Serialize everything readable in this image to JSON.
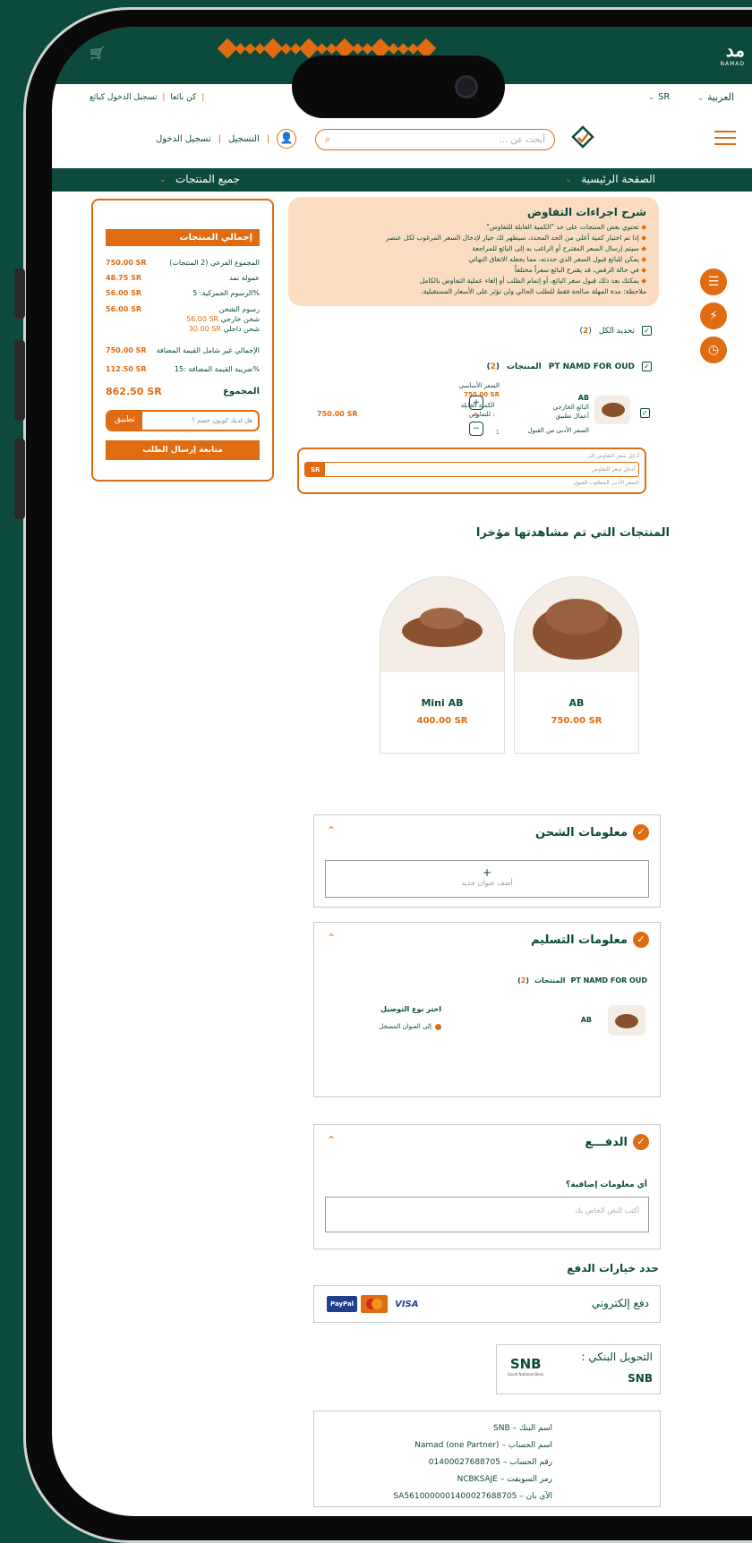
{
  "header": {
    "logo": "مد",
    "logo_sub": "NAMAD",
    "language": "العربية",
    "currency": "SR",
    "login_link": "تسجيل الدخول كبائع",
    "seller_link": "كن بائعا",
    "register": "التسجيل",
    "login": "تسجيل الدخول",
    "search_placeholder": "أبحث عن ...",
    "nav_home": "الصفحة الرئيسية",
    "nav_products": "جميع المنتجات"
  },
  "negotiation": {
    "title": "شرح اجراءات التفاوض",
    "lines": [
      "تحتوي بعض المنتجات على حد \"الكمية القابلة للتفاوض\"",
      "إذا تم اختيار كمية أعلى من الحد المحدد، سيظهر لك خيار لإدخال السعر المرغوب لكل عنصر",
      "سيتم إرسال السعر المقترح أو الراغب به إلى البائع للمراجعة",
      "يمكن للبائع قبول السعر الذي حددته، مما يجعله الاتفاق النهائي",
      "في حالة الرفض، قد يقترح البائع سعراً مختلفاً",
      "يمكنك بعد ذلك قبول سعر البائع، أو إتمام الطلب أو إلغاء عملية التفاوض بالكامل"
    ],
    "note": "ملاحظة: مدة المهلة صالحة فقط للطلب الحالي ولن تؤثر على الأسعار المستقبلية."
  },
  "cart": {
    "select_all": "تحديد الكل",
    "select_count": "2",
    "store_label": "PT NAMD FOR OUD",
    "store_products": "المنتجات",
    "store_count": "2",
    "item": {
      "name": "AB",
      "seller": "البائع الخارجي",
      "seller_sub": "أعمال تطبيق",
      "min_price_label": "السعر الأدنى من القبول",
      "base_price_label": "السعر الأساسي",
      "base_price": "750.00 SR",
      "neg_qty_label": "الكمية القابلة للتفاوض :",
      "neg_qty": "1",
      "qty": "1",
      "line_total": "750.00 SR"
    },
    "neg_hint_top": "أدخل سعر التفاوض إلى",
    "neg_placeholder": "أدخل سعر التفاوض",
    "neg_currency": "SR",
    "neg_hint_bottom": "السعر الأدنى المطلوب للقبول"
  },
  "summary": {
    "title": "إجمالي المنتجات",
    "rows": [
      {
        "label": "المجموع الفرعي (2 المنتجات)",
        "value": "750.00 SR"
      },
      {
        "label": "عمولة نمد",
        "value": "48.75 SR"
      },
      {
        "label": "الرسوم الجمركية: 5%",
        "value": "56.00 SR"
      }
    ],
    "shipping_label": "رسوم الشحن",
    "shipping_value": "56.00 SR",
    "shipping_ext_label": "شحن خارجي",
    "shipping_ext_value": "56.00 SR",
    "shipping_int_label": "شحن داخلي",
    "shipping_int_value": "30.00 SR",
    "total_ex_label": "الإجمالي غير شامل القيمة المضافة",
    "total_ex_value": "750.00 SR",
    "vat_label": "ضريبة القيمة المضافة :15%",
    "vat_value": "112.50 SR",
    "grand_label": "المجموع",
    "grand_value": "862.50 SR",
    "coupon_placeholder": "هل لديك كوبون خصم ؟",
    "apply": "تطبيق",
    "submit": "متابعة إرسال الطلب"
  },
  "recent": {
    "title": "المنتجات التي تم مشاهدتها مؤخرا",
    "items": [
      {
        "name": "AB",
        "price": "750.00 SR"
      },
      {
        "name": "Mini AB",
        "price": "400.00 SR"
      }
    ]
  },
  "shipping": {
    "title": "معلومات الشحن",
    "add_plus": "+",
    "add_label": "أضف عنوان جديد"
  },
  "delivery": {
    "title": "معلومات التسليم",
    "store_label": "PT NAMD FOR OUD",
    "store_products": "المنتجات",
    "store_count": "2",
    "item_name": "AB",
    "method_title": "اختر نوع التوصيل",
    "method_option": "إلى العنوان المسجل"
  },
  "payment": {
    "title": "الدفـــع",
    "extra_label": "أي معلومات إضافية؟",
    "extra_placeholder": "أكتب النص الخاص بك",
    "options_title": "حدد خيارات الدفع",
    "electronic": "دفع إلكتروني",
    "paypal": "PayPal",
    "visa": "VISA",
    "bank_label": "التحويل البنكي :",
    "bank_name": "SNB",
    "bank_logo": "SNB",
    "bank_logo_sub": "Saudi National Bank",
    "details": [
      "اسم البنك – SNB",
      "اسم الحساب – Namad (one Partner)",
      "رقم الحساب – 01400027688705",
      "رمز السويفت – NCBKSAJE",
      "الآي بان – SA5610000001400027688705"
    ]
  },
  "colors": {
    "brand": "#0c4a3d",
    "accent": "#e06b10",
    "peach": "#f9dcc1"
  }
}
